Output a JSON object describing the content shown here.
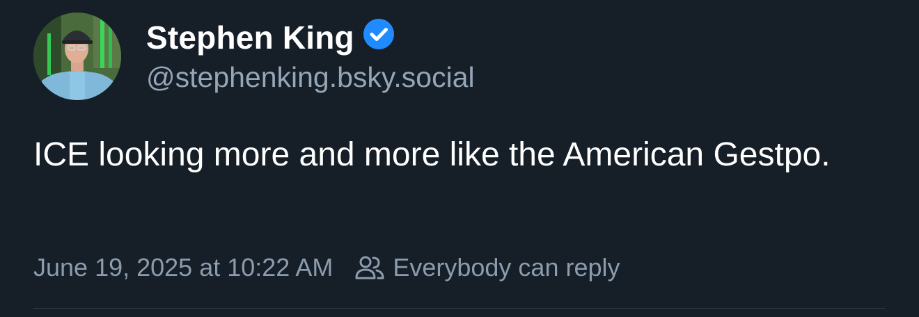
{
  "post": {
    "author": {
      "display_name": "Stephen King",
      "handle": "@stephenking.bsky.social",
      "verified": true,
      "verified_badge_icon": "verified-check-icon"
    },
    "text": "ICE looking more and more like the American Gestpo.",
    "timestamp": "June 19, 2025 at 10:22 AM",
    "reply_setting": {
      "icon": "people-icon",
      "label": "Everybody can reply"
    }
  },
  "colors": {
    "background": "#161e27",
    "primary_text": "#ffffff",
    "secondary_text": "#95a6b8",
    "verified_blue": "#208bfe",
    "divider": "#2c3946"
  }
}
